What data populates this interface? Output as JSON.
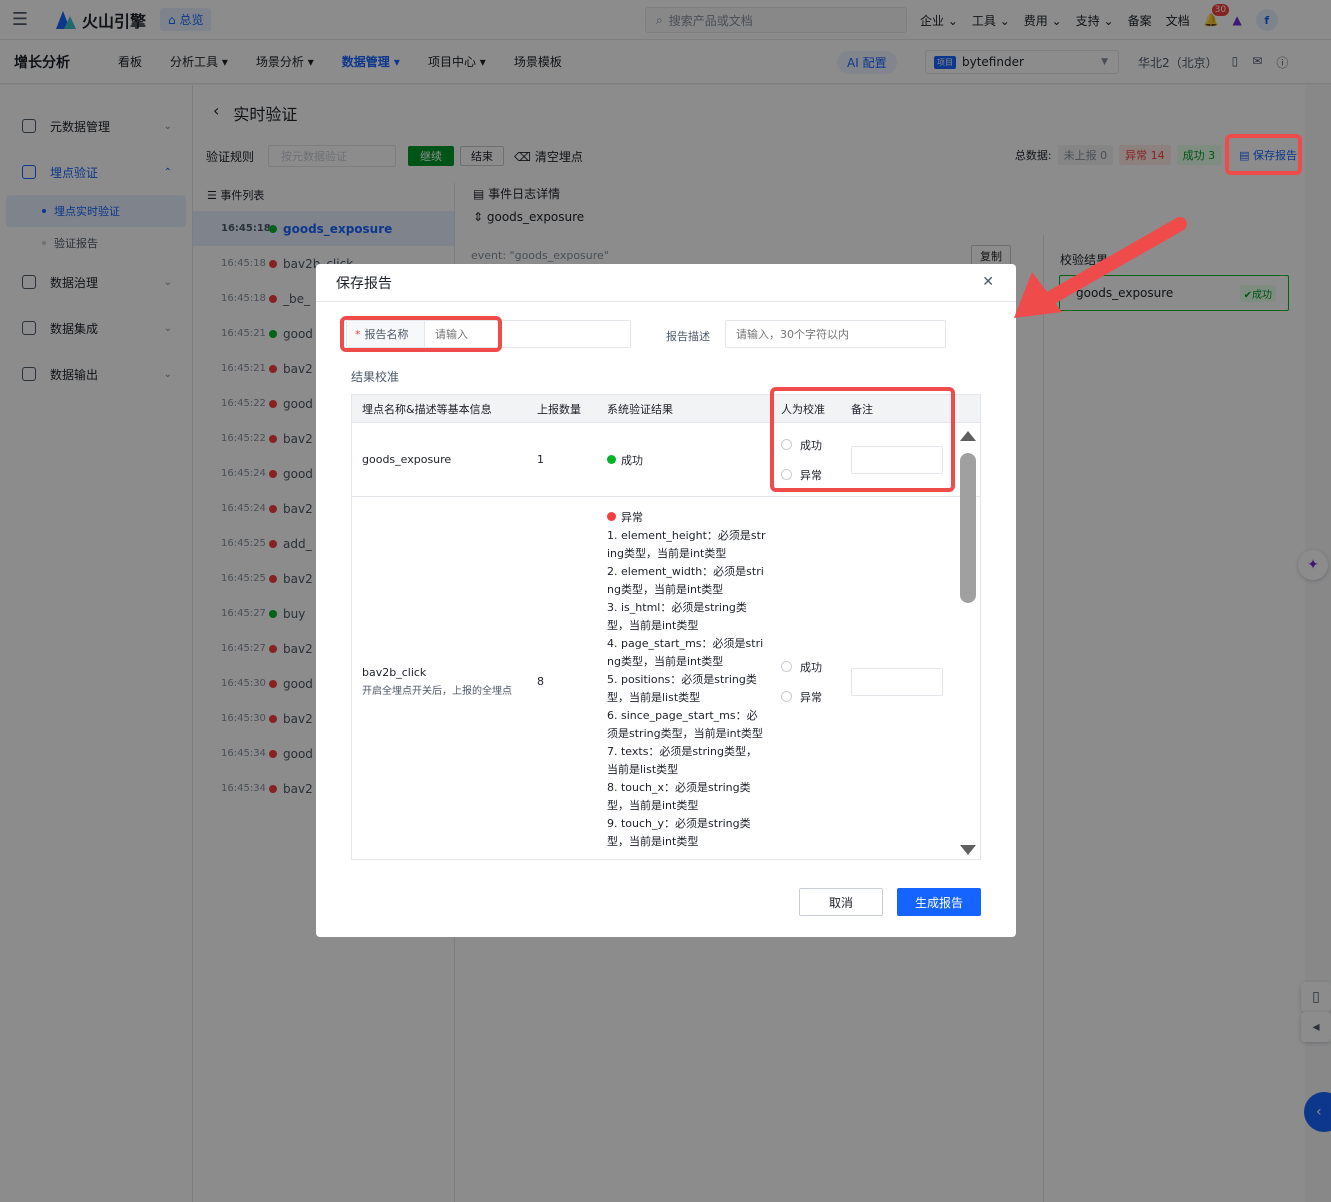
{
  "topbar": {
    "brand": "火山引擎",
    "overview": "总览",
    "search_placeholder": "搜索产品或文档",
    "nav": [
      "企业",
      "工具",
      "费用",
      "支持",
      "备案",
      "文档"
    ],
    "notification_count": "30",
    "avatar_letter": "f"
  },
  "subnav": {
    "product": "增长分析",
    "items": [
      "看板",
      "分析工具",
      "场景分析",
      "数据管理",
      "项目中心",
      "场景模板"
    ],
    "ai_button": "AI 配置",
    "project_tag": "项目",
    "project_name": "bytefinder",
    "region": "华北2（北京）"
  },
  "sidebar": {
    "items": [
      "元数据管理",
      "埋点验证",
      "数据治理",
      "数据集成",
      "数据输出"
    ],
    "sub_items": [
      "埋点实时验证",
      "验证报告"
    ]
  },
  "page": {
    "title": "实时验证",
    "rule_label": "验证规则",
    "rule_placeholder": "按元数据验证",
    "continue": "继续",
    "end": "结束",
    "clear": "清空埋点",
    "total_label": "总数据:",
    "unreported": "未上报 0",
    "abnormal": "异常 14",
    "success": "成功 3",
    "save_report": "保存报告",
    "event_list_title": "事件列表",
    "detail_title": "事件日志详情",
    "detail_event": "goods_exposure",
    "event_line": "event: \"goods_exposure\"",
    "copy": "复制",
    "verify_result": "校验结果",
    "verify_event": "goods_exposure",
    "verify_status": "成功"
  },
  "events": [
    {
      "time": "16:45:18",
      "name": "goods_exposure",
      "status": "ok"
    },
    {
      "time": "16:45:18",
      "name": "bav2b_click",
      "status": "err"
    },
    {
      "time": "16:45:18",
      "name": "_be_",
      "status": "err"
    },
    {
      "time": "16:45:21",
      "name": "good",
      "status": "ok"
    },
    {
      "time": "16:45:21",
      "name": "bav2",
      "status": "err"
    },
    {
      "time": "16:45:22",
      "name": "good",
      "status": "err"
    },
    {
      "time": "16:45:22",
      "name": "bav2",
      "status": "err"
    },
    {
      "time": "16:45:24",
      "name": "good",
      "status": "err"
    },
    {
      "time": "16:45:24",
      "name": "bav2",
      "status": "err"
    },
    {
      "time": "16:45:25",
      "name": "add_",
      "status": "err"
    },
    {
      "time": "16:45:25",
      "name": "bav2",
      "status": "err"
    },
    {
      "time": "16:45:27",
      "name": "buy",
      "status": "ok"
    },
    {
      "time": "16:45:27",
      "name": "bav2",
      "status": "err"
    },
    {
      "time": "16:45:30",
      "name": "good",
      "status": "err"
    },
    {
      "time": "16:45:30",
      "name": "bav2",
      "status": "err"
    },
    {
      "time": "16:45:34",
      "name": "good",
      "status": "err"
    },
    {
      "time": "16:45:34",
      "name": "bav2",
      "status": "err"
    }
  ],
  "modal": {
    "title": "保存报告",
    "name_label": "报告名称",
    "name_placeholder": "请输入",
    "desc_label": "报告描述",
    "desc_placeholder": "请输入，30个字符以内",
    "section": "结果校准",
    "columns": [
      "埋点名称&描述等基本信息",
      "上报数量",
      "系统验证结果",
      "人为校准",
      "备注"
    ],
    "radio_success": "成功",
    "radio_abnormal": "异常",
    "rows": [
      {
        "name": "goods_exposure",
        "desc": "",
        "count": "1",
        "result": "成功"
      },
      {
        "name": "bav2b_click",
        "desc": "开启全埋点开关后，上报的全埋点",
        "count": "8",
        "result": "异常"
      }
    ],
    "errors": [
      "1. element_height：必须是string类型，当前是int类型",
      "2. element_width：必须是string类型，当前是int类型",
      "3. is_html：必须是string类型，当前是int类型",
      "4. page_start_ms：必须是string类型，当前是int类型",
      "5. positions：必须是string类型，当前是list类型",
      "6. since_page_start_ms：必须是string类型，当前是int类型",
      "7. texts：必须是string类型，当前是list类型",
      "8. touch_x：必须是string类型，当前是int类型",
      "9. touch_y：必须是string类型，当前是int类型"
    ],
    "cancel": "取消",
    "generate": "生成报告"
  },
  "colors": {
    "primary": "#1664ff",
    "annotation": "#f04b4b",
    "success": "#00b42a",
    "error": "#f53f3f"
  }
}
